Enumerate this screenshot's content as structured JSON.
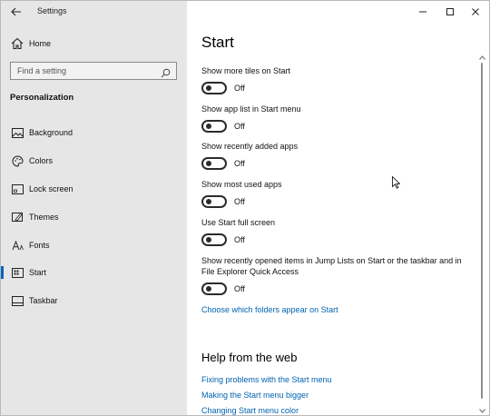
{
  "app_title": "Settings",
  "nav": {
    "home_label": "Home",
    "search_placeholder": "Find a setting",
    "section_heading": "Personalization",
    "items": [
      {
        "label": "Background",
        "icon": "image-icon"
      },
      {
        "label": "Colors",
        "icon": "palette-icon"
      },
      {
        "label": "Lock screen",
        "icon": "lock-screen-icon"
      },
      {
        "label": "Themes",
        "icon": "brush-icon"
      },
      {
        "label": "Fonts",
        "icon": "font-icon"
      },
      {
        "label": "Start",
        "icon": "start-icon",
        "selected": true
      },
      {
        "label": "Taskbar",
        "icon": "taskbar-icon"
      }
    ]
  },
  "page": {
    "title": "Start",
    "settings": [
      {
        "label": "Show more tiles on Start",
        "state": "Off"
      },
      {
        "label": "Show app list in Start menu",
        "state": "Off"
      },
      {
        "label": "Show recently added apps",
        "state": "Off"
      },
      {
        "label": "Show most used apps",
        "state": "Off"
      },
      {
        "label": "Use Start full screen",
        "state": "Off"
      },
      {
        "label_line1": "Show recently opened items in Jump Lists on Start or the taskbar and in",
        "label_line2": "File Explorer Quick Access",
        "state": "Off"
      }
    ],
    "folders_link": "Choose which folders appear on Start",
    "help": {
      "title": "Help from the web",
      "links": [
        "Fixing problems with the Start menu",
        "Making the Start menu bigger",
        "Changing Start menu color"
      ]
    }
  },
  "colors": {
    "accent": "#0067b8",
    "link": "#0063b1",
    "nav_bg": "#e6e6e6"
  }
}
